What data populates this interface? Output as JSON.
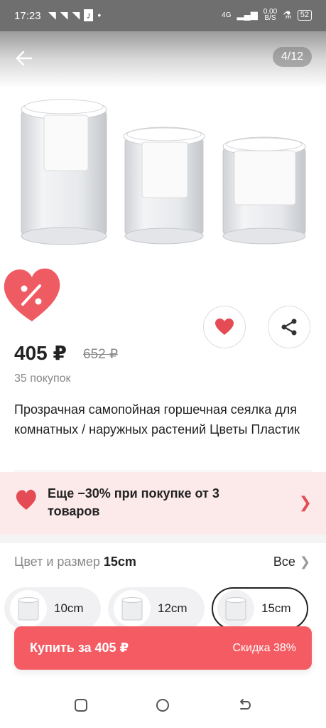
{
  "status_bar": {
    "time": "17:23",
    "network": "4G",
    "speed": "0,00",
    "speed_unit": "B/S",
    "battery": "52"
  },
  "gallery": {
    "counter": "4/12"
  },
  "product": {
    "price": "405 ₽",
    "old_price": "652 ₽",
    "purchases": "35 покупок",
    "title": "Прозрачная самопойная горшечная сеялка для комнатных / наружных растений Цветы Пластик"
  },
  "promo": {
    "text": "Еще −30% при покупке от 3 товаров"
  },
  "variants": {
    "label": "Цвет и размер",
    "selected": "15cm",
    "all_label": "Все",
    "chips": [
      {
        "label": "10cm"
      },
      {
        "label": "12cm"
      },
      {
        "label": "15cm"
      }
    ]
  },
  "buy": {
    "label": "Купить за 405 ₽",
    "discount": "Скидка 38%"
  },
  "colors": {
    "accent": "#f45b62",
    "promo_bg": "#fceaea",
    "heart": "#e44b55"
  }
}
